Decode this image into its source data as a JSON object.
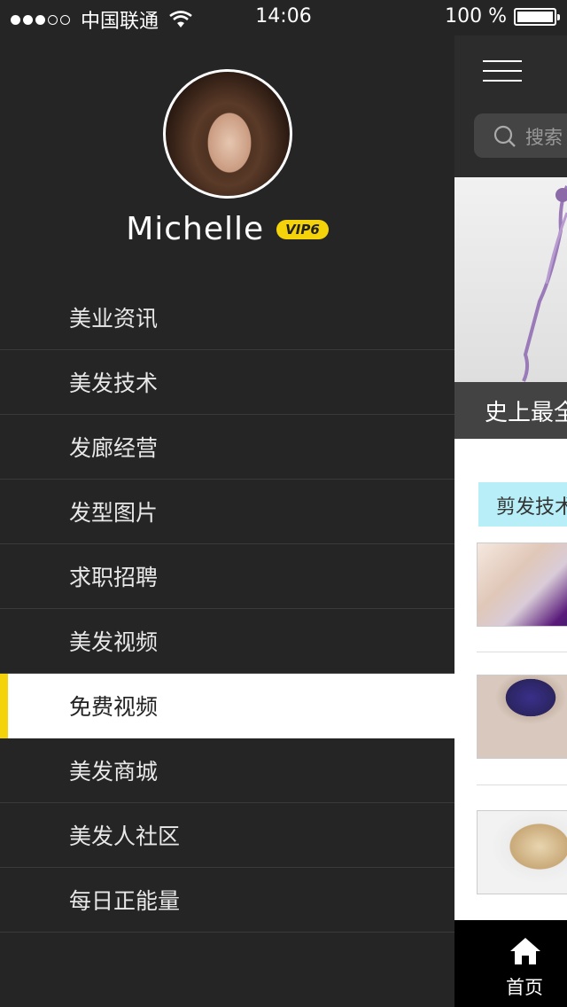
{
  "status_bar": {
    "carrier": "中国联通",
    "time": "14:06",
    "battery": "100 %",
    "signal_bars": 3
  },
  "profile": {
    "username": "Michelle",
    "vip_badge": "VIP6"
  },
  "menu": {
    "items": [
      {
        "label": "美业资讯"
      },
      {
        "label": "美发技术"
      },
      {
        "label": "发廊经营"
      },
      {
        "label": "发型图片"
      },
      {
        "label": "求职招聘"
      },
      {
        "label": "美发视频"
      },
      {
        "label": "免费视频",
        "active": true
      },
      {
        "label": "美发商城"
      },
      {
        "label": "美发人社区"
      },
      {
        "label": "每日正能量"
      }
    ]
  },
  "main": {
    "search_placeholder": "搜索",
    "banner_caption": "史上最全",
    "tag": "剪发技术",
    "tabbar": {
      "home_label": "首页"
    }
  },
  "colors": {
    "accent": "#f5d30a",
    "drawer_bg": "#252525",
    "tag_bg": "#b7eef7"
  }
}
